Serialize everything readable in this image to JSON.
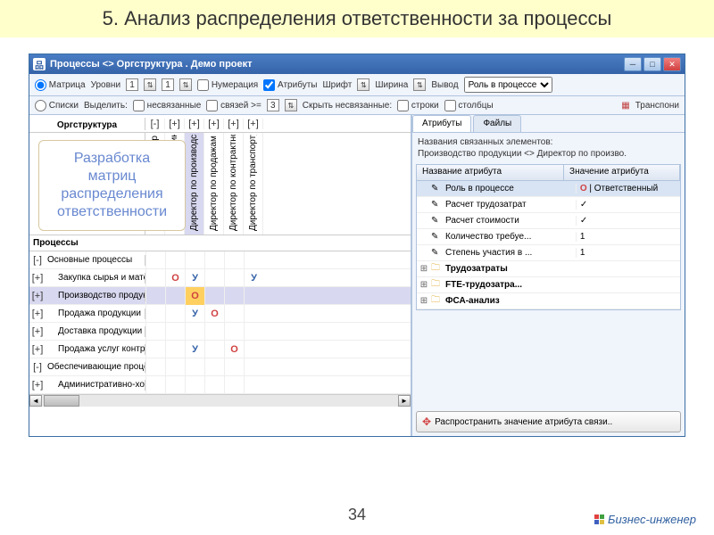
{
  "slide_title": "5. Анализ распределения ответственности за процессы",
  "page_number": "34",
  "footer_brand": "Бизнес-инженер",
  "window": {
    "title": "Процессы <> Оргструктура . Демо проект",
    "toolbar1": {
      "matrix": "Матрица",
      "levels": "Уровни",
      "lvl_a": "1",
      "lvl_b": "1",
      "numbering": "Нумерация",
      "attributes": "Атрибуты",
      "font": "Шрифт",
      "width": "Ширина",
      "output": "Вывод",
      "output_value": "Роль в процессе"
    },
    "toolbar2": {
      "lists": "Списки",
      "highlight": "Выделить:",
      "unlinked": "несвязанные",
      "links_ge": "связей >=",
      "links_val": "3",
      "hide_unlinked": "Скрыть несвязанные:",
      "rows": "строки",
      "cols": "столбцы",
      "transpose": "Транспони"
    }
  },
  "overlay": {
    "l1": "Разработка",
    "l2": "матриц",
    "l3": "распределения",
    "l4": "ответственности"
  },
  "matrix": {
    "org_header": "Оргструктура",
    "proc_header": "Процессы",
    "col_exp": [
      "[-]",
      "[+]",
      "[+]",
      "[+]",
      "[+]",
      "[+]"
    ],
    "columns": [
      "Генеральный директор",
      "Директор по снабжению",
      "Директор по производс...",
      "Директор по продажам ...",
      "Директор по контрактно...",
      "Директор по транспорту"
    ],
    "rows": [
      {
        "exp": "[-]",
        "label": "Основные процессы",
        "indent": false,
        "cells": [
          "",
          "",
          "",
          "",
          "",
          ""
        ]
      },
      {
        "exp": "[+]",
        "label": "Закупка сырья и материалов",
        "indent": true,
        "cells": [
          "",
          "О",
          "У",
          "",
          "",
          "У"
        ]
      },
      {
        "exp": "[+]",
        "label": "Производство продукции",
        "indent": true,
        "sel": true,
        "cells": [
          "",
          "",
          "О",
          "",
          "",
          ""
        ],
        "hl": 2
      },
      {
        "exp": "[+]",
        "label": "Продажа продукции",
        "indent": true,
        "cells": [
          "",
          "",
          "У",
          "О",
          "",
          ""
        ]
      },
      {
        "exp": "[+]",
        "label": "Доставка продукции потребителям",
        "indent": true,
        "cells": [
          "",
          "",
          "",
          "",
          "",
          ""
        ]
      },
      {
        "exp": "[+]",
        "label": "Продажа услуг контрактного произ...",
        "indent": true,
        "cells": [
          "",
          "",
          "У",
          "",
          "О",
          ""
        ]
      },
      {
        "exp": "[-]",
        "label": "Обеспечивающие процессы",
        "indent": false,
        "cells": [
          "",
          "",
          "",
          "",
          "",
          ""
        ]
      },
      {
        "exp": "[+]",
        "label": "Административно-хозяйственное ...",
        "indent": true,
        "cells": [
          "",
          "",
          "",
          "",
          "",
          ""
        ]
      }
    ]
  },
  "right": {
    "tab_attr": "Атрибуты",
    "tab_files": "Файлы",
    "linked_label": "Названия связанных элементов:",
    "linked_value": "Производство продукции <> Директор по произво.",
    "col_name": "Название атрибута",
    "col_val": "Значение атрибута",
    "attrs": [
      {
        "ico": "✎",
        "name": "Роль в процессе",
        "val_o": "О",
        "val": " | Ответственный",
        "sel": true
      },
      {
        "ico": "✎",
        "name": "Расчет трудозатрат",
        "val": "✓"
      },
      {
        "ico": "✎",
        "name": "Расчет стоимости",
        "val": "✓"
      },
      {
        "ico": "✎",
        "name": "Количество требуе...",
        "val": "1"
      },
      {
        "ico": "✎",
        "name": "Степень участия в ...",
        "val": "1"
      }
    ],
    "folders": [
      "Трудозатраты",
      "FTE-трудозатра...",
      "ФСА-анализ"
    ],
    "propagate": "Распространить значение атрибута связи.."
  }
}
